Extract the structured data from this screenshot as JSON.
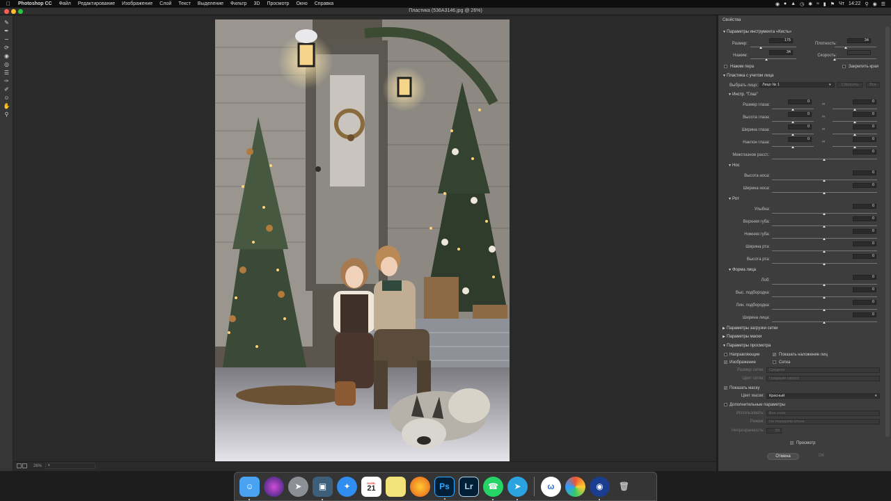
{
  "menubar": {
    "app": "Photoshop CC",
    "items": [
      "Файл",
      "Редактирование",
      "Изображение",
      "Слой",
      "Текст",
      "Выделение",
      "Фильтр",
      "3D",
      "Просмотр",
      "Окно",
      "Справка"
    ],
    "day": "Чт",
    "time": "14:22"
  },
  "window": {
    "title": "Пластика (536A3146.jpg @ 26%)"
  },
  "status": {
    "zoom": "26%"
  },
  "panel": {
    "title": "Свойства",
    "brush": {
      "header": "Параметры инструмента «Кисть»",
      "size_label": "Размер:",
      "size_value": "175",
      "density_label": "Плотность:",
      "density_value": "34",
      "pressure_label": "Нажим:",
      "pressure_value": "34",
      "rate_label": "Скорость:",
      "pen_pressure": "Нажим пера",
      "pin_edges": "Закрепить края"
    },
    "face": {
      "header": "Пластика с учетом лица",
      "select_label": "Выбрать лицо:",
      "select_value": "Лицо № 1",
      "reset": "Сбросить",
      "all": "Все"
    },
    "eyes": {
      "header": "Инстр. \"Глаз\"",
      "rows": [
        {
          "label": "Размер глаза:",
          "left": "0",
          "right": "0"
        },
        {
          "label": "Высота глаза:",
          "left": "0",
          "right": "0"
        },
        {
          "label": "Ширина глаза:",
          "left": "0",
          "right": "0"
        },
        {
          "label": "Наклон глаза:",
          "left": "0",
          "right": "0"
        }
      ],
      "distance_label": "Межглазное расст.:",
      "distance_value": "0"
    },
    "nose": {
      "header": "Нос",
      "rows": [
        {
          "label": "Высота носа:",
          "value": "0"
        },
        {
          "label": "Ширина носа:",
          "value": "0"
        }
      ]
    },
    "mouth": {
      "header": "Рот",
      "rows": [
        {
          "label": "Улыбка:",
          "value": "0"
        },
        {
          "label": "Верхняя губа:",
          "value": "0"
        },
        {
          "label": "Нижняя губа:",
          "value": "0"
        },
        {
          "label": "Ширина рта:",
          "value": "0"
        },
        {
          "label": "Высота рта:",
          "value": "0"
        }
      ]
    },
    "face_shape": {
      "header": "Форма лица",
      "rows": [
        {
          "label": "Лоб:",
          "value": "0"
        },
        {
          "label": "Выс. подбородка:",
          "value": "0"
        },
        {
          "label": "Лин. подбородка:",
          "value": "0"
        },
        {
          "label": "Ширина лица:",
          "value": "0"
        }
      ]
    },
    "mesh_load": "Параметры загрузки сетки",
    "mask_options": "Параметры маски",
    "view": {
      "header": "Параметры просмотра",
      "guides": "Направляющие",
      "face_overlay": "Показать наложение лиц",
      "image": "Изображение",
      "mesh": "Сетка",
      "mesh_size_label": "Размер сетки:",
      "mesh_size_value": "Средняя",
      "mesh_color_label": "Цвет сетки:",
      "mesh_color_value": "Градации серого",
      "show_mask": "Показать маску",
      "mask_color_label": "Цвет маски:",
      "mask_color_value": "Красный",
      "extra": "Дополнительные параметры",
      "use_label": "Использовать:",
      "use_value": "Все слои",
      "mode_label": "Режим:",
      "mode_value": "На переднем плане",
      "opacity_label": "Непрозрачность:",
      "opacity_value": "50"
    },
    "preview": "Просмотр",
    "cancel": "Отмена",
    "ok": "OK"
  },
  "dock": {
    "calendar_month": "НОЯБ.",
    "calendar_day": "21",
    "ps": "Ps",
    "lr": "Lr"
  }
}
